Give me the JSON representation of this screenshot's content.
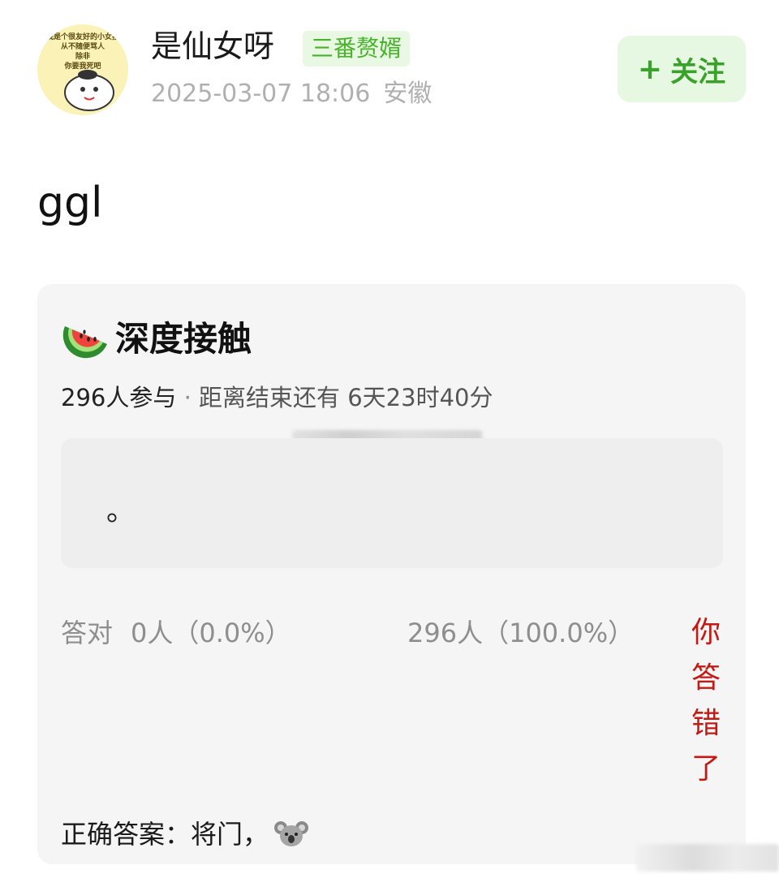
{
  "post": {
    "avatar_text": "我是个很友好的小女孩\n从不随便骂人\n除非\n你要我死吧",
    "username": "是仙女呀",
    "badge": "三番赘婿",
    "date": "2025-03-07 18:06",
    "location": "安徽",
    "follow_plus": "+",
    "follow_label": "关注",
    "text": "ggl"
  },
  "quiz": {
    "title_emoji": "watermelon-icon",
    "title": "深度接触",
    "participants": "296人参与",
    "separator": " · ",
    "remaining": "距离结束还有 6天23时40分",
    "option_text": "。",
    "correct_label": "答对",
    "correct_count": "0人（0.0%）",
    "wrong_count": "296人（100.0%）",
    "result_chars": [
      "你",
      "答",
      "错",
      "了"
    ],
    "answer_label": "正确答案：将门，",
    "answer_emoji": "koala-icon"
  },
  "colors": {
    "accent_green": "#47b32a",
    "follow_bg": "#e6f7e2",
    "wrong_red": "#c21a14",
    "card_bg": "#f5f5f5"
  }
}
